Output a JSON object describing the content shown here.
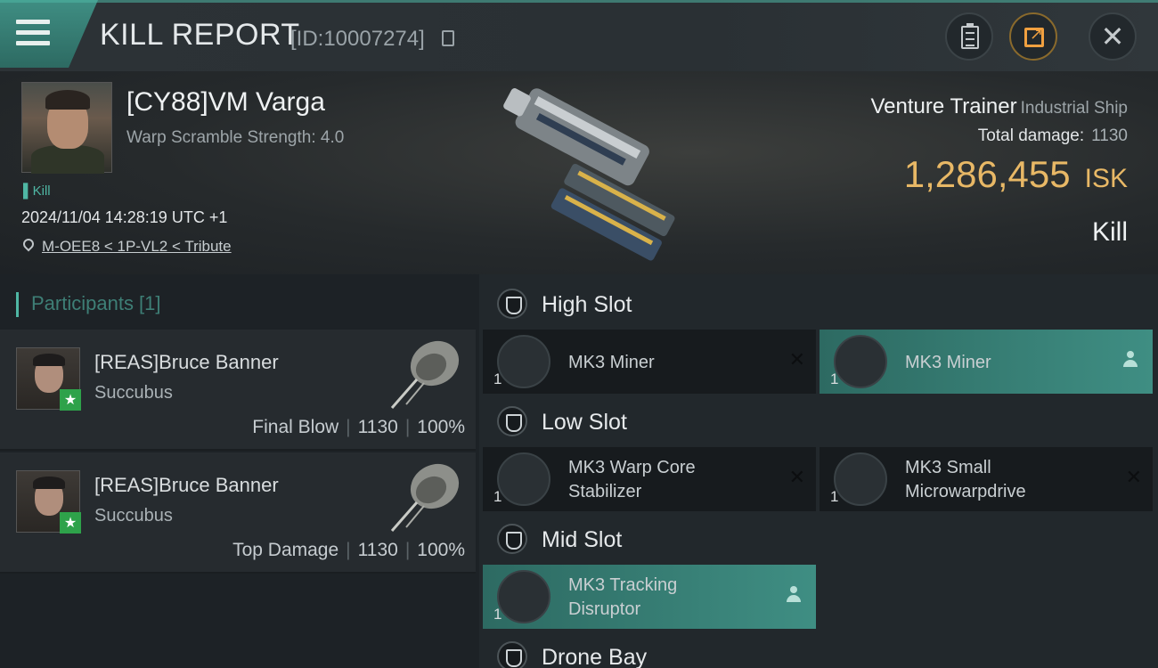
{
  "header": {
    "title": "KILL REPORT",
    "report_id": "[ID:10007274]"
  },
  "victim": {
    "name": "[CY88]VM Varga",
    "warp_scramble": "Warp Scramble Strength: 4.0",
    "tag": "Kill",
    "datetime": "2024/11/04 14:28:19 UTC +1",
    "location": "M-OEE8 < 1P-VL2 < Tribute",
    "ship_name": "Venture Trainer",
    "ship_class": "Industrial Ship",
    "total_damage_label": "Total damage:",
    "total_damage": "1130",
    "isk_value": "1,286,455",
    "isk_unit": "ISK",
    "result": "Kill"
  },
  "participants": {
    "header": "Participants [1]",
    "rows": [
      {
        "name": "[REAS]Bruce Banner",
        "ship": "Succubus",
        "role": "Final Blow",
        "damage": "1130",
        "percent": "100%"
      },
      {
        "name": "[REAS]Bruce Banner",
        "ship": "Succubus",
        "role": "Top Damage",
        "damage": "1130",
        "percent": "100%"
      }
    ]
  },
  "fittings": {
    "high": {
      "label": "High Slot",
      "modules": [
        {
          "qty": "1",
          "name1": "MK3 Miner",
          "name2": "",
          "state": "destroyed"
        },
        {
          "qty": "1",
          "name1": "MK3 Miner",
          "name2": "",
          "state": "dropped"
        }
      ]
    },
    "low": {
      "label": "Low Slot",
      "modules": [
        {
          "qty": "1",
          "name1": "MK3 Warp Core",
          "name2": "Stabilizer",
          "state": "destroyed"
        },
        {
          "qty": "1",
          "name1": "MK3 Small",
          "name2": "Microwarpdrive",
          "state": "destroyed"
        }
      ]
    },
    "mid": {
      "label": "Mid Slot",
      "modules": [
        {
          "qty": "1",
          "name1": "MK3 Tracking",
          "name2": "Disruptor",
          "state": "dropped"
        }
      ]
    },
    "drone": {
      "label": "Drone Bay"
    },
    "destroyed_glyph": "✕"
  },
  "colors": {
    "accent": "#4fb7a4",
    "isk": "#e8b866",
    "dropped_bg": "#3f8e83"
  }
}
